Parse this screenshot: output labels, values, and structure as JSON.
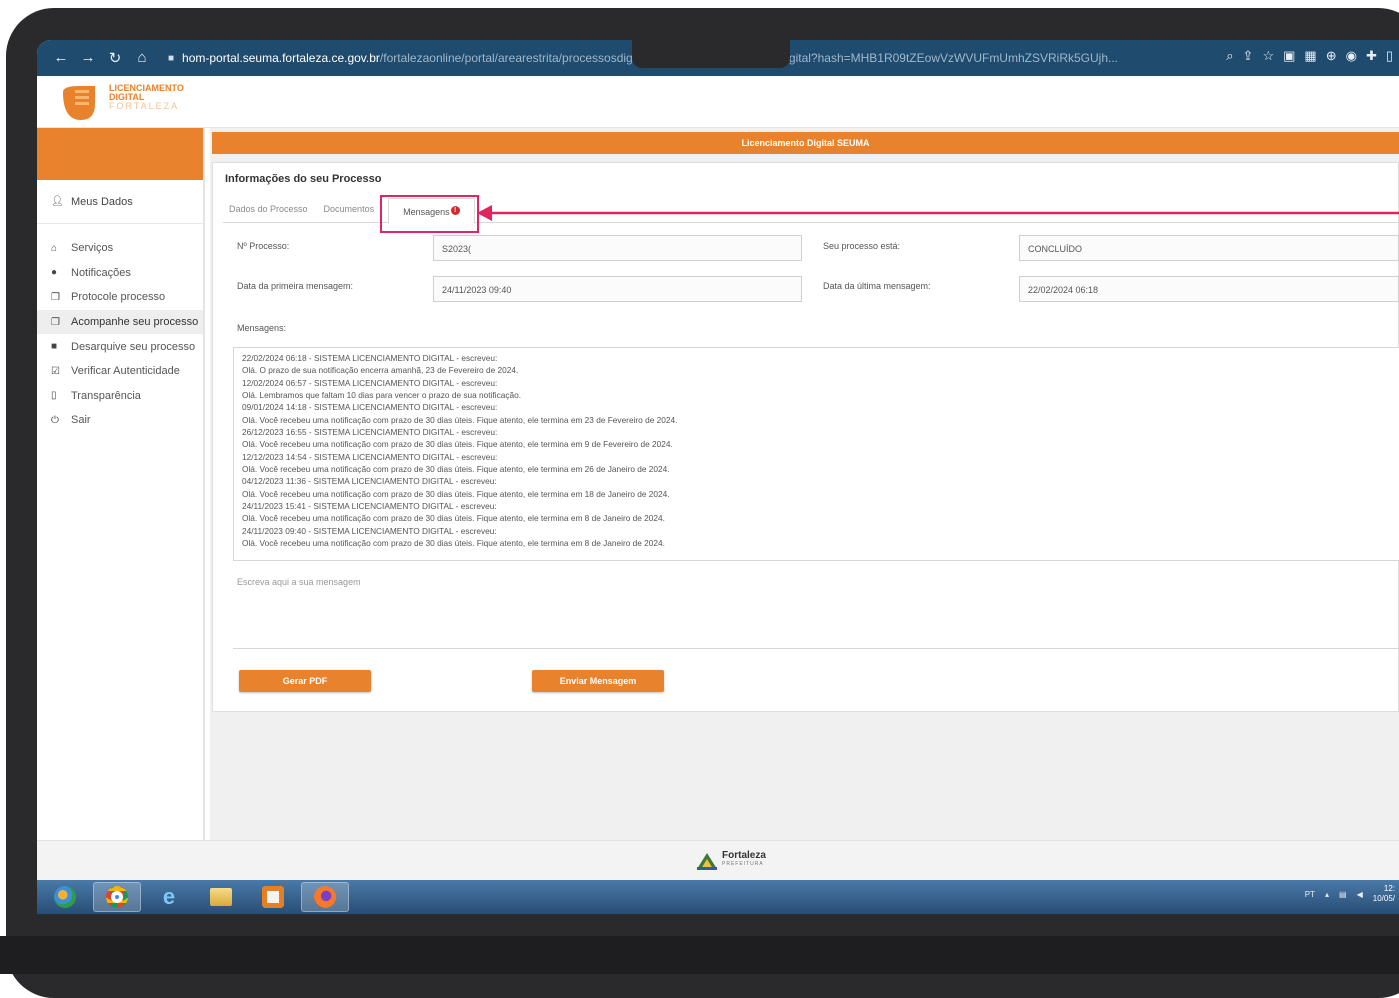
{
  "browser": {
    "url_host": "hom-portal.seuma.fortaleza.ce.gov.br",
    "url_path": "/fortalezaonline/portal/arearestrita/processosdigit",
    "url_tail": "odigital?hash=MHB1R09tZEowVzWVUFmUmhZSVRiRk5GUjh..."
  },
  "header": {
    "logo_line1": "LICENCIAMENTO",
    "logo_line2": "DIGITAL",
    "logo_line3": "FORTALEZA"
  },
  "sidebar": {
    "user_label": "Meus Dados",
    "items": [
      {
        "label": "Serviços",
        "icon": "home-icon",
        "glyph": "⌂"
      },
      {
        "label": "Notificações",
        "icon": "alert-icon",
        "glyph": "●"
      },
      {
        "label": "Protocole processo",
        "icon": "copy-icon",
        "glyph": "❐"
      },
      {
        "label": "Acompanhe seu processo",
        "icon": "copy-icon",
        "glyph": "❐"
      },
      {
        "label": "Desarquive seu processo",
        "icon": "archive-icon",
        "glyph": "■"
      },
      {
        "label": "Verificar Autenticidade",
        "icon": "check-icon",
        "glyph": "☑"
      },
      {
        "label": "Transparência",
        "icon": "file-icon",
        "glyph": "▯"
      },
      {
        "label": "Sair",
        "icon": "power-icon",
        "glyph": "⏻"
      }
    ]
  },
  "main": {
    "banner": "Licenciamento Digital SEUMA",
    "title": "Informações do seu Processo",
    "tabs": [
      "Dados do Processo",
      "Documentos",
      "Mensagens"
    ],
    "badge": "!",
    "fields": {
      "processo_label": "Nº Processo:",
      "processo_value": "S2023(",
      "status_label": "Seu processo está:",
      "status_value": "CONCLUÍDO",
      "primeira_label": "Data da primeira mensagem:",
      "primeira_value": "24/11/2023 09:40",
      "ultima_label": "Data da última mensagem:",
      "ultima_value": "22/02/2024 06:18",
      "mensagens_label": "Mensagens:"
    },
    "messages": [
      "22/02/2024 06:18 - SISTEMA LICENCIAMENTO DIGITAL - escreveu:",
      "Olá. O prazo de sua notificação encerra amanhã, 23 de Fevereiro de 2024.",
      "12/02/2024 06:57 - SISTEMA LICENCIAMENTO DIGITAL - escreveu:",
      "Olá. Lembramos que faltam 10 dias para vencer o prazo de sua notificação.",
      "09/01/2024 14:18 - SISTEMA LICENCIAMENTO DIGITAL - escreveu:",
      "Olá. Você recebeu uma notificação com prazo de 30 dias úteis. Fique atento, ele termina em 23 de Fevereiro de 2024.",
      "26/12/2023 16:55 - SISTEMA LICENCIAMENTO DIGITAL - escreveu:",
      "Olá. Você recebeu uma notificação com prazo de 30 dias úteis. Fique atento, ele termina em 9 de Fevereiro de 2024.",
      "12/12/2023 14:54 - SISTEMA LICENCIAMENTO DIGITAL - escreveu:",
      "Olá. Você recebeu uma notificação com prazo de 30 dias úteis. Fique atento, ele termina em 26 de Janeiro de 2024.",
      "04/12/2023 11:36 - SISTEMA LICENCIAMENTO DIGITAL - escreveu:",
      "Olá. Você recebeu uma notificação com prazo de 30 dias úteis. Fique atento, ele termina em 18 de Janeiro de 2024.",
      "24/11/2023 15:41 - SISTEMA LICENCIAMENTO DIGITAL - escreveu:",
      "Olá. Você recebeu uma notificação com prazo de 30 dias úteis. Fique atento, ele termina em 8 de Janeiro de 2024.",
      "24/11/2023 09:40 - SISTEMA LICENCIAMENTO DIGITAL - escreveu:",
      "Olá. Você recebeu uma notificação com prazo de 30 dias úteis. Fique atento, ele termina em 8 de Janeiro de 2024."
    ],
    "message_placeholder": "Escreva aqui a sua mensagem",
    "btn_pdf": "Gerar PDF",
    "btn_send": "Enviar Mensagem"
  },
  "footer": {
    "logo_name": "Fortaleza",
    "logo_sub": "PREFEITURA"
  },
  "taskbar": {
    "tray_lang": "PT",
    "clock_time": "12:",
    "clock_date": "10/05/"
  },
  "colors": {
    "accent": "#e8822d",
    "highlight": "#e0245e",
    "badge": "#d6262d",
    "browser_bar": "#1f4b6e"
  }
}
